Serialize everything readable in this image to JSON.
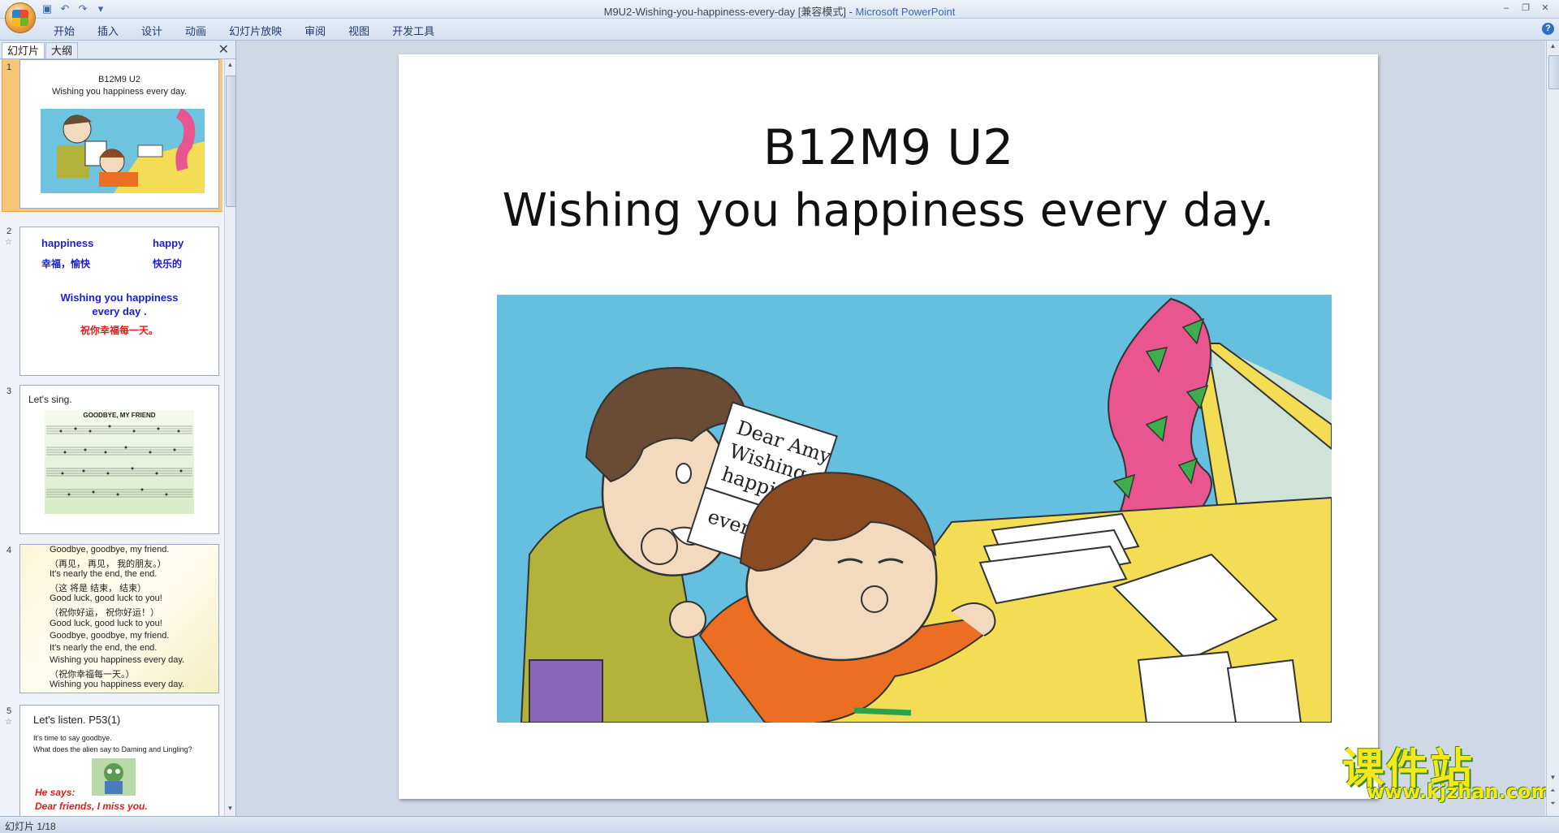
{
  "window": {
    "title_doc": "M9U2-Wishing-you-happiness-every-day [兼容模式] - ",
    "title_app": "Microsoft PowerPoint",
    "controls": [
      "–",
      "❐",
      "✕"
    ]
  },
  "qat": [
    "save-icon",
    "undo-icon",
    "redo-icon",
    "customize-icon"
  ],
  "ribbon": {
    "tabs": [
      "开始",
      "插入",
      "设计",
      "动画",
      "幻灯片放映",
      "审阅",
      "视图",
      "开发工具"
    ],
    "help": "?"
  },
  "panel": {
    "tab_slides": "幻灯片",
    "tab_outline": "大纲",
    "close": "✕"
  },
  "thumbs": {
    "s1": {
      "num": "1",
      "line1": "B12M9 U2",
      "line2": "Wishing you  happiness every day."
    },
    "s2": {
      "num": "2",
      "w1": "happiness",
      "w2": "happy",
      "c1": "幸福，愉快",
      "c2": "快乐的",
      "e1": "Wishing  you  happiness",
      "e2": "every  day .",
      "cn": "祝你幸福每一天。"
    },
    "s3": {
      "num": "3",
      "title": "Let's sing.",
      "song": "GOODBYE, MY FRIEND"
    },
    "s4": {
      "num": "4",
      "lines": [
        "Goodbye,  goodbye,  my  friend.",
        "（再见，    再见，   我的朋友。）",
        "It's  nearly  the  end,   the  end.",
        "（这 将是     结束，       结束）",
        "Good  luck, good  luck  to  you!",
        "（祝你好运，   祝你好运！）",
        "Good  luck, good  luck  to  you!",
        "Goodbye,  goodbye,  my  friend.",
        "It's  nearly  the  end,   the  end.",
        "Wishing  you  happiness  every  day.",
        "（祝你幸福每一天。）",
        "Wishing  you  happiness  every  day."
      ]
    },
    "s5": {
      "num": "5",
      "title": "Let's listen. P53(1)",
      "l1": "It's time to say goodbye.",
      "l2": "What does the alien say to Daming and Lingling?",
      "says": "He says:",
      "quote": "Dear friends, I miss you."
    }
  },
  "slide": {
    "title1": "B12M9 U2",
    "title2": "Wishing you happiness every day.",
    "letter": [
      "Dear Amy",
      "Wishing you",
      "happiness",
      "every day."
    ]
  },
  "status": {
    "text": "幻灯片 1/18"
  },
  "watermark": {
    "cn": "课件站",
    "url": "www.kjzhan.com"
  }
}
